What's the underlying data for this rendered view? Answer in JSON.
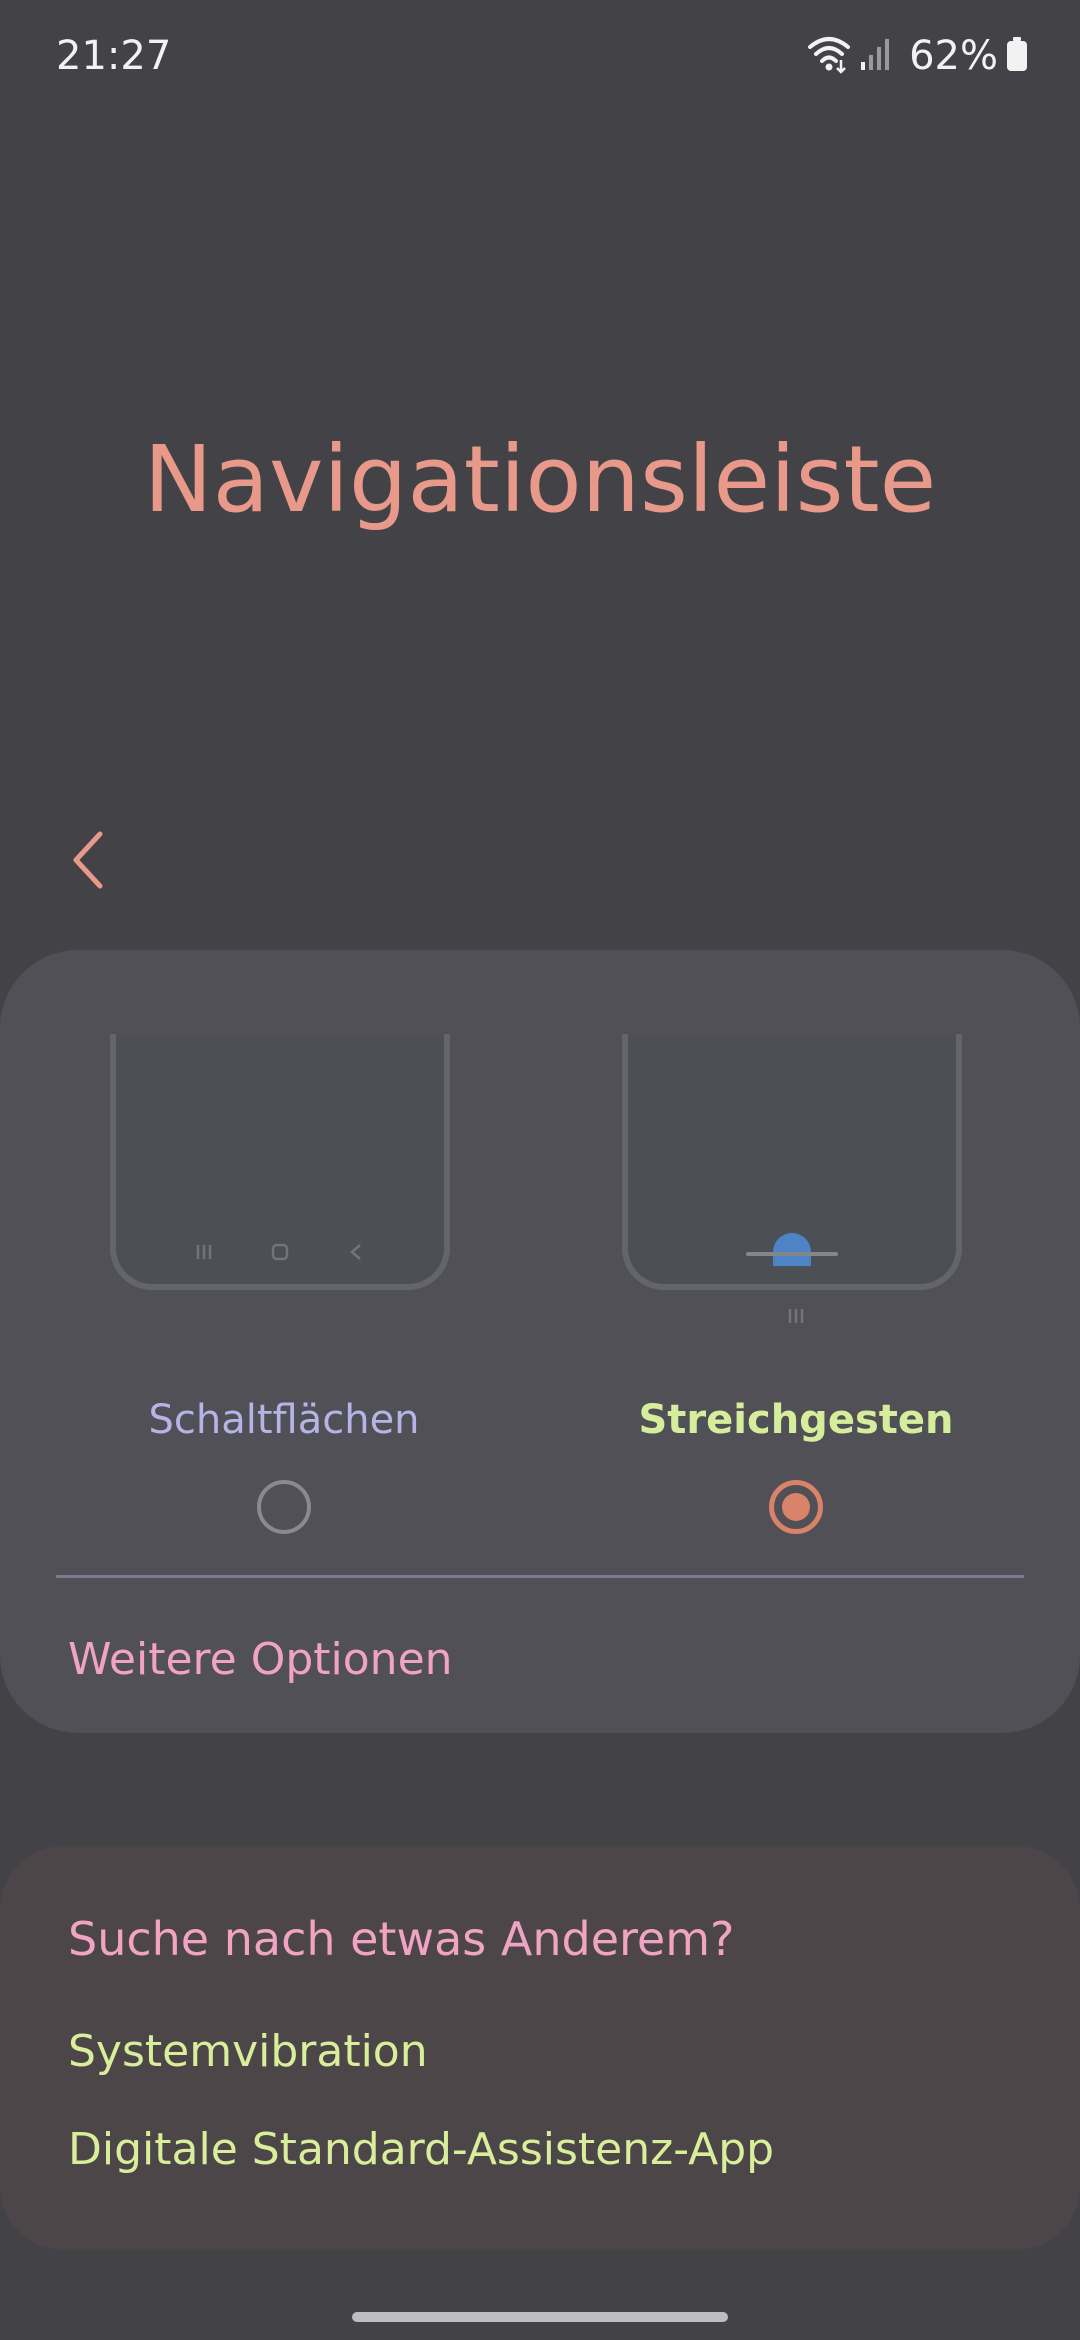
{
  "status_bar": {
    "time": "21:27",
    "battery_percent": "62%",
    "icons": [
      "wifi-icon",
      "cellular-signal-icon",
      "battery-icon"
    ]
  },
  "page": {
    "title": "Navigationsleiste",
    "back_icon": "chevron-left-icon"
  },
  "navigation_types": {
    "options": [
      {
        "label": "Schaltflächen",
        "selected": false,
        "preview_icons": [
          "recents-icon",
          "home-icon",
          "back-icon"
        ]
      },
      {
        "label": "Streichgesten",
        "selected": true,
        "preview_icons": [
          "gesture-hint-icon",
          "recents-icon"
        ]
      }
    ],
    "more_options_label": "Weitere Optionen"
  },
  "suggestions": {
    "title": "Suche nach etwas Anderem?",
    "links": [
      "Systemvibration",
      "Digitale Standard-Assistenz-App"
    ]
  },
  "colors": {
    "background": "#434247",
    "title": "#e8998a",
    "selected_radio": "#d8836a",
    "selected_label": "#d6ee9c",
    "unselected_label": "#b6b4e6",
    "pink_text": "#f0a4c2",
    "link_text": "#d8ee9a"
  }
}
